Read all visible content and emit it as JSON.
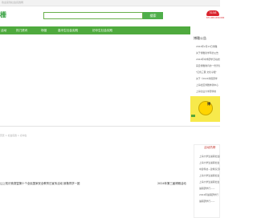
{
  "topbar": {
    "text": "欢迎来到社会实践网"
  },
  "logo": {
    "text": "栅"
  },
  "search": {
    "button": "搜索"
  },
  "badge": {
    "text": "3158",
    "sub": "671.001.000.000"
  },
  "nav": [
    {
      "label": "活动",
      "active": true
    },
    {
      "label": "热门资讯"
    },
    {
      "label": "场馆"
    },
    {
      "label": "高中生社会实践"
    },
    {
      "label": "初中生社会实践"
    }
  ],
  "right_panel": {
    "title": "博雅公告",
    "items": [
      "2024年2月13日博雅",
      "关于博雅新学年的公告",
      "2024年中学研学活动的通知",
      "来自博雅教育的一份贺信",
      "\"红色三晋·文化寻根\"",
      "关于《2024寒假研学",
      "上海社区博雅体验中心",
      "上海创业大学研学的"
    ]
  },
  "promo": {
    "label": "博"
  },
  "breadcrumb": "首页 > 社会实践 > 初中生",
  "right_bottom": {
    "title": "活动热榜",
    "items": [
      "上海大学生暑期社会实践",
      "上海大学生暑期社会",
      "中建科技—建筑家活动",
      "上海大学生暑期社会",
      "上海大学生暑期社会",
      "暑期研学行——",
      "2024年暑期研学行",
      "暑期研学行——"
    ]
  },
  "headlines": {
    "left": "让上知识竞赛暨第十个全民国家安全教育日宣传活动 致敬同学一团",
    "right": "2024年第三届博雅活动"
  }
}
